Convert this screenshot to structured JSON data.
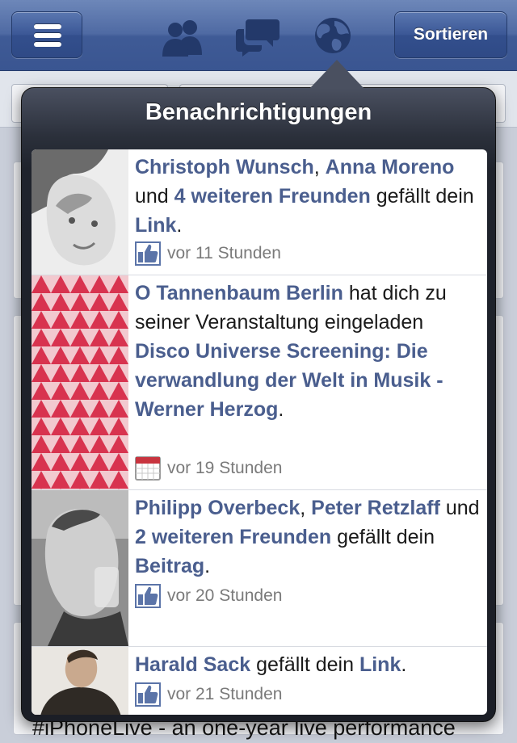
{
  "navbar": {
    "sort_label": "Sortieren",
    "icons": [
      "menu-icon",
      "friends-icon",
      "messages-icon",
      "globe-icon"
    ]
  },
  "background": {
    "post_text": "#iPhoneLive - an one-year live performance"
  },
  "popover": {
    "title": "Benachrichtigungen",
    "items": [
      {
        "thumb": "person-photo",
        "actor1": "Christoph Wunsch",
        "sep1": ", ",
        "actor2": "Anna Moreno",
        "and": " und ",
        "others": "4 weiteren Freunden",
        "verb": " gefällt dein ",
        "object": "Link",
        "end": ".",
        "type_icon": "like-icon",
        "time": "vor 11 Stunden"
      },
      {
        "thumb": "event-pattern-image",
        "actor1": "O Tannenbaum Berlin",
        "verb": " hat dich zu seiner Veranstaltung eingeladen ",
        "object": "Disco Universe Screening: Die verwandlung der Welt in Musik - Werner Herzog",
        "end": ".",
        "type_icon": "calendar-icon",
        "time": "vor 19 Stunden"
      },
      {
        "thumb": "person-photo",
        "actor1": "Philipp Overbeck",
        "sep1": ", ",
        "actor2": "Peter Retzlaff",
        "and": " und ",
        "others": "2 weiteren Freunden",
        "verb": " gefällt dein ",
        "object": "Beitrag",
        "end": ".",
        "type_icon": "like-icon",
        "time": "vor 20 Stunden"
      },
      {
        "thumb": "person-photo",
        "actor1": "Harald Sack",
        "verb": " gefällt dein ",
        "object": "Link",
        "end": ".",
        "type_icon": "like-icon",
        "time": "vor 21 Stunden"
      }
    ]
  },
  "colors": {
    "navbar": "#3f5b96",
    "link": "#4a5e8e",
    "popover": "#1f232c",
    "meta_text": "#7a7a7a"
  }
}
